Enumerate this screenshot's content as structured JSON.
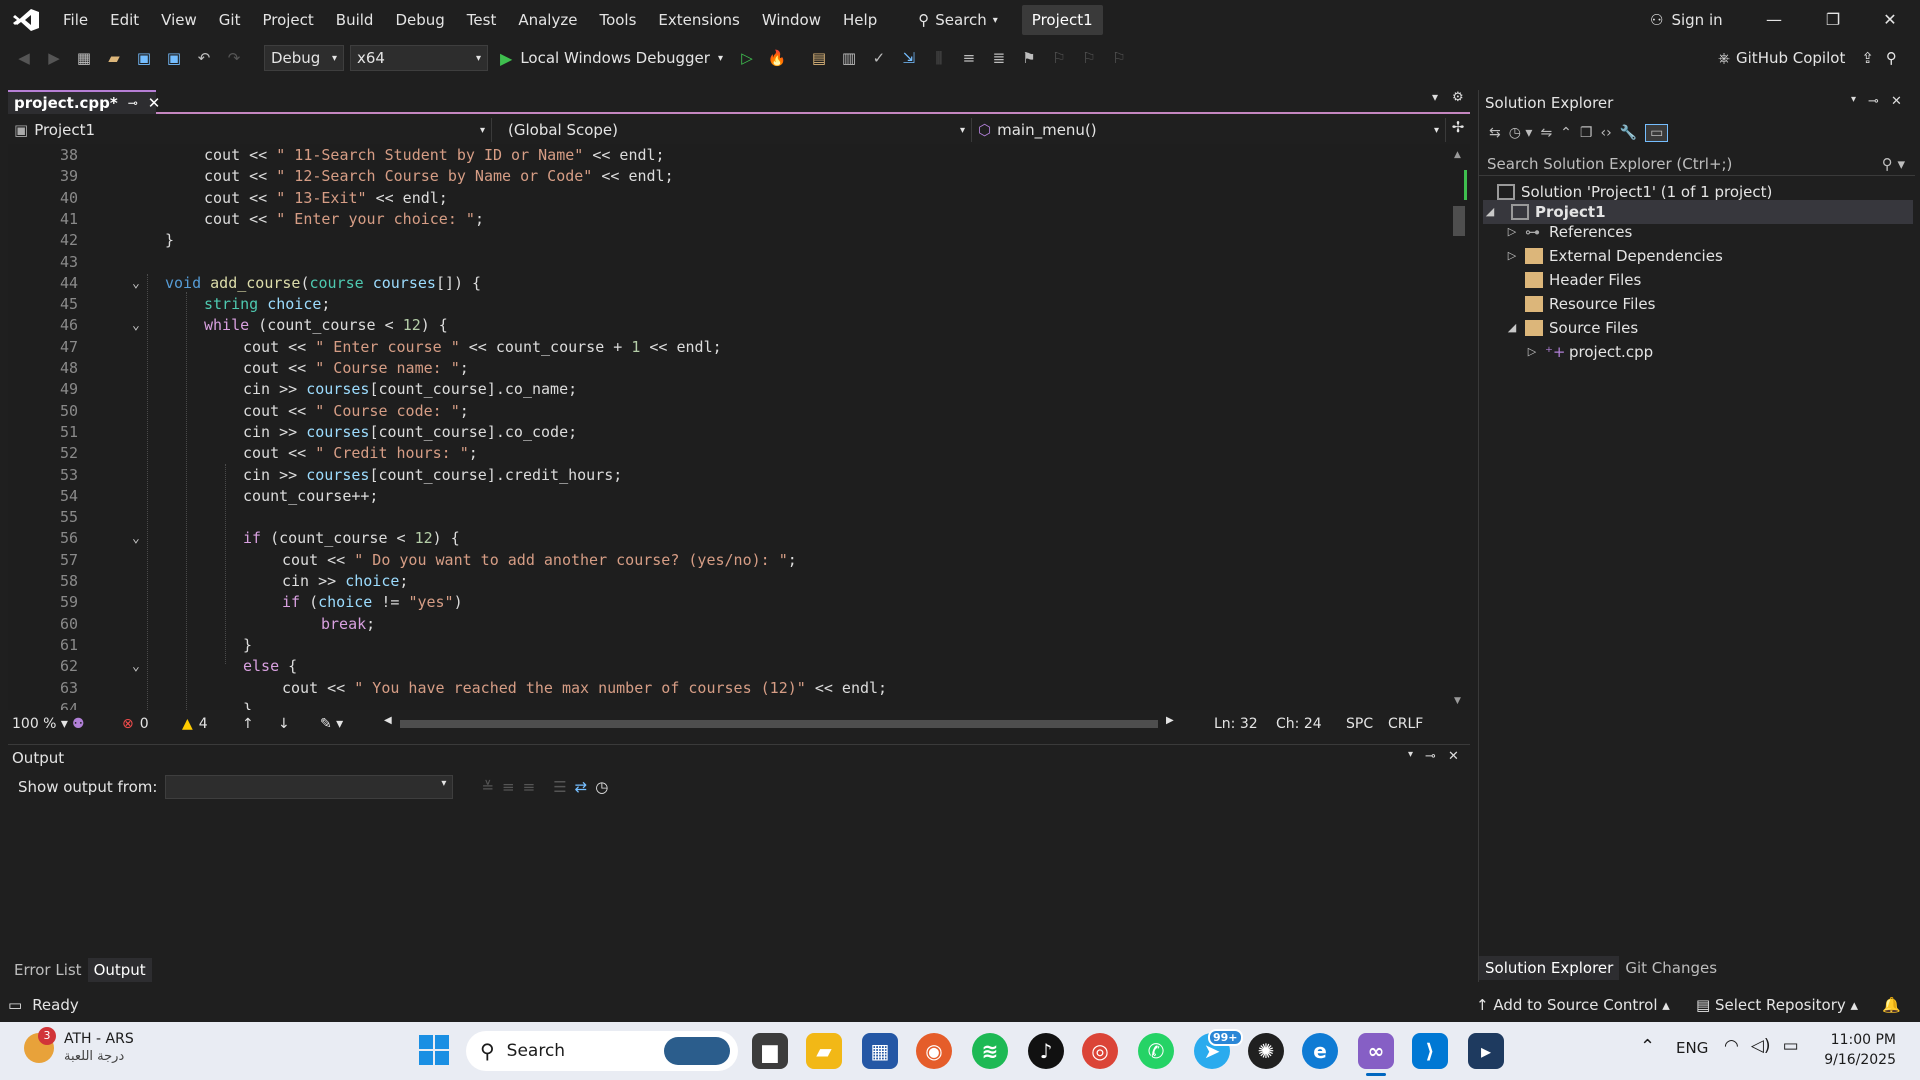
{
  "menu": {
    "items": [
      "File",
      "Edit",
      "View",
      "Git",
      "Project",
      "Build",
      "Debug",
      "Test",
      "Analyze",
      "Tools",
      "Extensions",
      "Window",
      "Help"
    ],
    "search_label": "Search",
    "project_badge": "Project1",
    "sign_in": "Sign in"
  },
  "toolbar": {
    "configuration": "Debug",
    "platform": "x64",
    "debugger": "Local Windows Debugger",
    "copilot": "GitHub Copilot"
  },
  "editor": {
    "tab_label": "project.cpp*",
    "nav_project": "Project1",
    "nav_scope": "(Global Scope)",
    "nav_function": "main_menu()",
    "lines": [
      {
        "n": "38",
        "html": "cout << <span class='str'>\" 11-Search Student by ID or Name\"</span> << endl;",
        "indent": 1
      },
      {
        "n": "39",
        "html": "cout << <span class='str'>\" 12-Search Course by Name or Code\"</span> << endl;",
        "indent": 1
      },
      {
        "n": "40",
        "html": "cout << <span class='str'>\" 13-Exit\"</span> << endl;",
        "indent": 1
      },
      {
        "n": "41",
        "html": "cout << <span class='str'>\" Enter your choice: \"</span>;",
        "indent": 1
      },
      {
        "n": "42",
        "html": "}",
        "indent": 0
      },
      {
        "n": "43",
        "html": "",
        "indent": 0
      },
      {
        "n": "44",
        "html": "<span class='kw'>void</span> <span class='fn'>add_course</span>(<span class='ty'>course</span> <span class='var'>courses</span>[]) {",
        "indent": 0,
        "fold": true
      },
      {
        "n": "45",
        "html": "<span class='ty'>string</span> <span class='var'>choice</span>;",
        "indent": 1
      },
      {
        "n": "46",
        "html": "<span class='ctl'>while</span> (count_course < <span class='num'>12</span>) {",
        "indent": 1,
        "fold": true
      },
      {
        "n": "47",
        "html": "cout << <span class='str'>\" Enter course \"</span> << count_course + <span class='num'>1</span> << endl;",
        "indent": 2
      },
      {
        "n": "48",
        "html": "cout << <span class='str'>\" Course name: \"</span>;",
        "indent": 2
      },
      {
        "n": "49",
        "html": "cin >> <span class='var'>courses</span>[count_course].co_name;",
        "indent": 2
      },
      {
        "n": "50",
        "html": "cout << <span class='str'>\" Course code: \"</span>;",
        "indent": 2
      },
      {
        "n": "51",
        "html": "cin >> <span class='var'>courses</span>[count_course].co_code;",
        "indent": 2
      },
      {
        "n": "52",
        "html": "cout << <span class='str'>\" Credit hours: \"</span>;",
        "indent": 2
      },
      {
        "n": "53",
        "html": "cin >> <span class='var'>courses</span>[count_course].credit_hours;",
        "indent": 2
      },
      {
        "n": "54",
        "html": "count_course++;",
        "indent": 2
      },
      {
        "n": "55",
        "html": "",
        "indent": 2
      },
      {
        "n": "56",
        "html": "<span class='ctl'>if</span> (count_course < <span class='num'>12</span>) {",
        "indent": 2,
        "fold": true
      },
      {
        "n": "57",
        "html": "cout << <span class='str'>\" Do you want to add another course? (yes/no): \"</span>;",
        "indent": 3
      },
      {
        "n": "58",
        "html": "cin >> <span class='var'>choice</span>;",
        "indent": 3
      },
      {
        "n": "59",
        "html": "<span class='ctl'>if</span> (<span class='var'>choice</span> != <span class='str'>\"yes\"</span>)",
        "indent": 3
      },
      {
        "n": "60",
        "html": "<span class='ctl'>break</span>;",
        "indent": 4
      },
      {
        "n": "61",
        "html": "}",
        "indent": 2
      },
      {
        "n": "62",
        "html": "<span class='ctl'>else</span> {",
        "indent": 2,
        "fold": true
      },
      {
        "n": "63",
        "html": "cout << <span class='str'>\" You have reached the max number of courses (12)\"</span> << endl;",
        "indent": 3
      },
      {
        "n": "64",
        "html": "}",
        "indent": 2
      }
    ],
    "zoom": "100 %",
    "errors": "0",
    "warnings": "4",
    "ln": "Ln: 32",
    "ch": "Ch: 24",
    "spc": "SPC",
    "crlf": "CRLF"
  },
  "output": {
    "title": "Output",
    "show_from": "Show output from:"
  },
  "bottom_tabs": [
    "Error List",
    "Output"
  ],
  "solution_explorer": {
    "title": "Solution Explorer",
    "search_placeholder": "Search Solution Explorer (Ctrl+;)",
    "solution": "Solution 'Project1' (1 of 1 project)",
    "project": "Project1",
    "references": "References",
    "external_deps": "External Dependencies",
    "header_files": "Header Files",
    "resource_files": "Resource Files",
    "source_files": "Source Files",
    "file": "project.cpp",
    "tab_se": "Solution Explorer",
    "tab_git": "Git Changes"
  },
  "status": {
    "ready": "Ready",
    "add_source": "Add to Source Control",
    "select_repo": "Select Repository"
  },
  "taskbar": {
    "weather_badge": "3",
    "weather_title": "ATH - ARS",
    "weather_sub": "درجة اللعبة",
    "search": "Search",
    "telegram_badge": "99+",
    "lang": "ENG",
    "time": "11:00 PM",
    "date": "9/16/2025"
  },
  "colors": {
    "accent": "#b77fd6",
    "keyword": "#569cd6",
    "string": "#d69d85"
  }
}
